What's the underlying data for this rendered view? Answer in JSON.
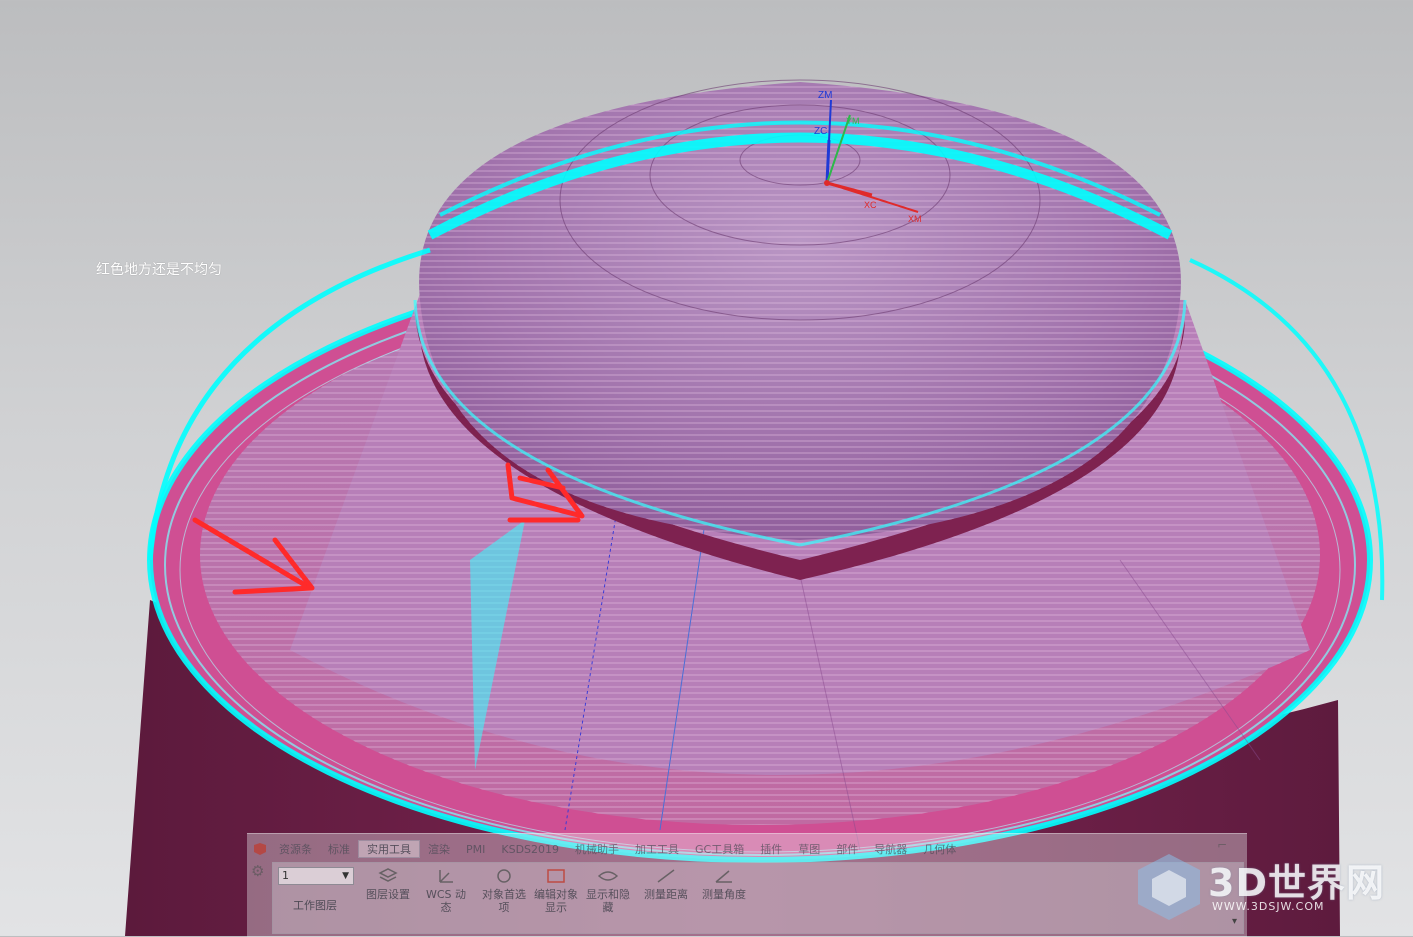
{
  "annotation": {
    "text": "红色地方还是不均匀"
  },
  "axes": {
    "zm": "ZM",
    "zc": "ZC",
    "ym": "YM",
    "xc": "XC",
    "xm": "XM"
  },
  "ribbon": {
    "tabs": [
      "资源条",
      "标准",
      "实用工具",
      "渲染",
      "PMI",
      "KSDS2019",
      "机械助手",
      "加工工具",
      "GC工具箱",
      "插件",
      "草图",
      "部件",
      "导航器",
      "几何体"
    ],
    "active_tab_index": 2,
    "layer_select_value": "1",
    "layer_label": "工作图层",
    "tools": [
      "图层设置",
      "WCS 动态",
      "对象首选项",
      "编辑对象显示",
      "显示和隐藏",
      "测量距离",
      "测量角度"
    ]
  },
  "watermark": {
    "brand": "3D世界网",
    "url": "WWW.3DSJW.COM"
  },
  "colors": {
    "model_magenta": "#a8285e",
    "model_dark": "#6e1f48",
    "toolpath_cyan": "#00ffff",
    "arrow_red": "#ff2a2a",
    "background": "#c9cacc"
  }
}
